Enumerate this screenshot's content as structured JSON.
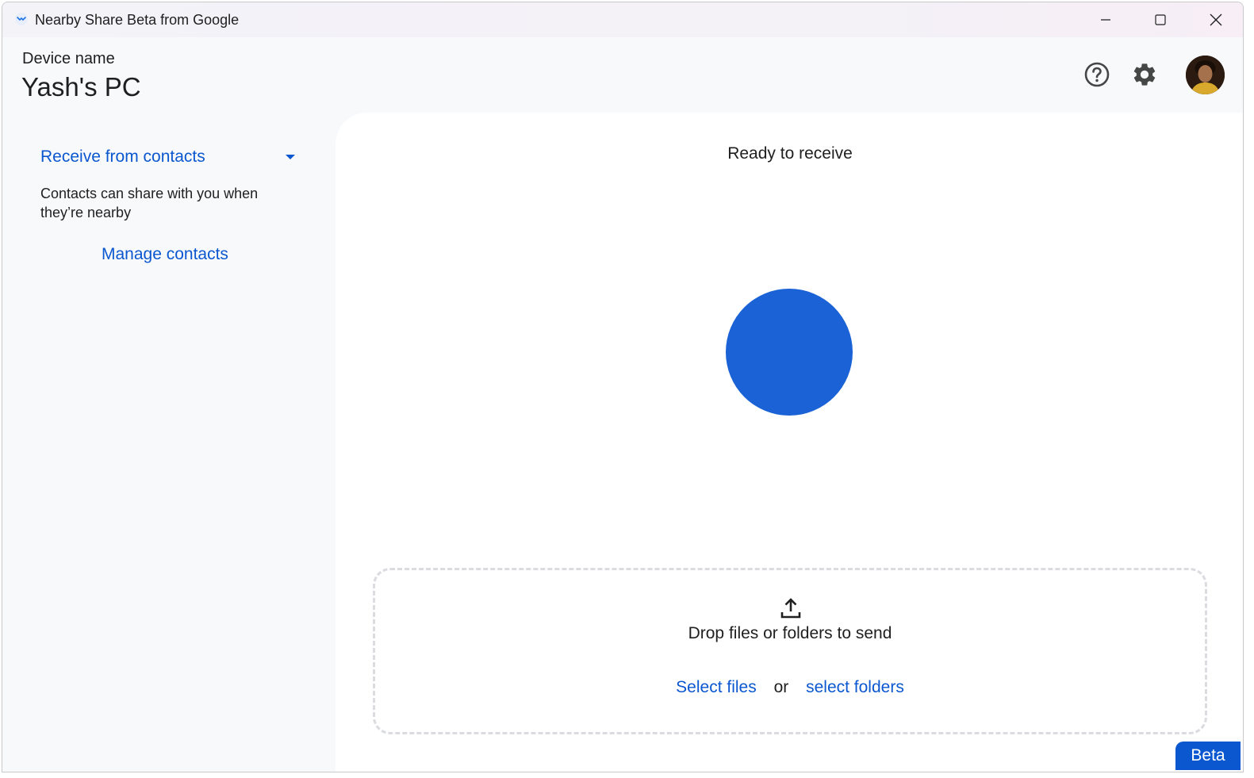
{
  "window": {
    "title": "Nearby Share Beta from Google"
  },
  "header": {
    "device_label": "Device name",
    "device_name": "Yash's PC"
  },
  "sidebar": {
    "receive_mode": "Receive from contacts",
    "description": "Contacts can share with you when they’re nearby",
    "manage_link": "Manage contacts"
  },
  "main": {
    "status": "Ready to receive",
    "drop_text": "Drop files or folders to send",
    "select_files": "Select files",
    "or_text": "or",
    "select_folders": "select folders"
  },
  "badge": {
    "label": "Beta"
  },
  "colors": {
    "accent": "#0b57d0",
    "circle": "#1a62d6",
    "panel_bg": "#ffffff",
    "app_bg": "#f8f9fb"
  },
  "icons": {
    "app": "nearby-share-icon",
    "help": "help-icon",
    "settings": "gear-icon",
    "dropdown": "dropdown-arrow-icon",
    "upload": "upload-icon"
  }
}
